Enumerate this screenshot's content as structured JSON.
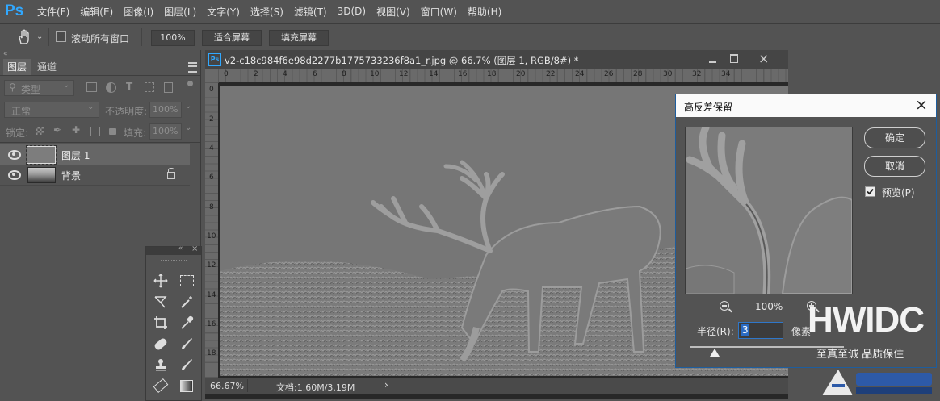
{
  "app": {
    "logo": "Ps"
  },
  "menu": [
    "文件(F)",
    "编辑(E)",
    "图像(I)",
    "图层(L)",
    "文字(Y)",
    "选择(S)",
    "滤镜(T)",
    "3D(D)",
    "视图(V)",
    "窗口(W)",
    "帮助(H)"
  ],
  "options": {
    "scroll_all": "滚动所有窗口",
    "zoom": "100%",
    "fit_screen": "适合屏幕",
    "fill_screen": "填充屏幕"
  },
  "panel": {
    "tab_layers": "图层",
    "tab_channels": "通道",
    "filter_kind": "类型",
    "blend_mode": "正常",
    "opacity_label": "不透明度:",
    "opacity_value": "100%",
    "lock_label": "锁定:",
    "fill_label": "填充:",
    "fill_value": "100%",
    "layers": [
      {
        "name": "图层 1",
        "selected": true
      },
      {
        "name": "背景",
        "locked": true
      }
    ]
  },
  "document": {
    "title": "v2-c18c984f6e98d2277b1775733236f8a1_r.jpg @ 66.7% (图层 1, RGB/8#) *",
    "ruler_top": [
      "0",
      "2",
      "4",
      "6",
      "8",
      "10",
      "12",
      "14",
      "16",
      "18",
      "20",
      "22",
      "24",
      "26",
      "28",
      "30",
      "32",
      "34"
    ],
    "ruler_left": [
      "0",
      "2",
      "4",
      "6",
      "8",
      "10",
      "12",
      "14",
      "16",
      "18"
    ],
    "zoom_status": "66.67%",
    "doc_info": "文档:1.60M/3.19M"
  },
  "dialog": {
    "title": "高反差保留",
    "ok": "确定",
    "cancel": "取消",
    "preview_label": "预览(P)",
    "preview_checked": true,
    "zoom": "100%",
    "radius_label": "半径(R):",
    "radius_value": "3",
    "radius_unit": "像素"
  },
  "watermark": {
    "main": "HWIDC",
    "sub": "至真至诚 品质保住"
  },
  "colors": {
    "ps_blue": "#31a8ff",
    "dialog_border": "#1d5d9e"
  }
}
